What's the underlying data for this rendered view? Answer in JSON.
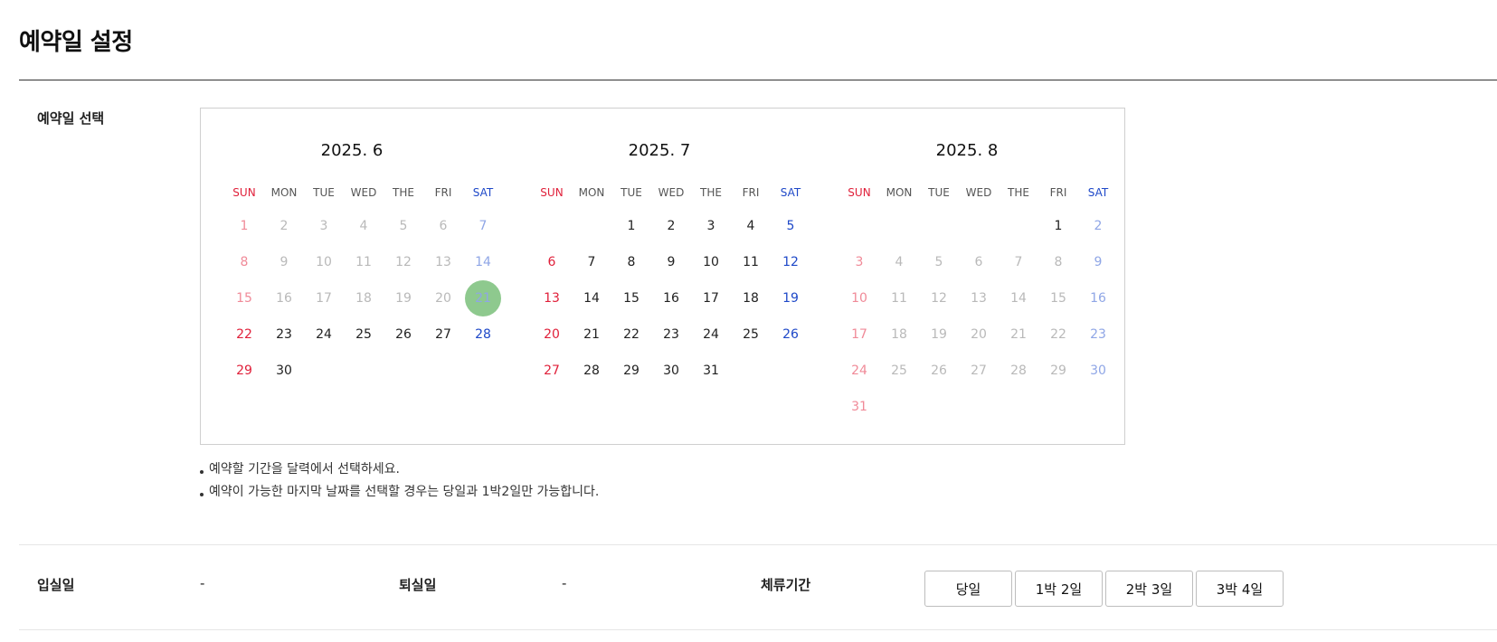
{
  "page": {
    "title": "예약일 설정"
  },
  "labels": {
    "select_date": "예약일 선택",
    "checkin": "입실일",
    "checkout": "퇴실일",
    "stay_period": "체류기간"
  },
  "values": {
    "checkin": "-",
    "checkout": "-"
  },
  "weekdays": [
    "SUN",
    "MON",
    "TUE",
    "WED",
    "THE",
    "FRI",
    "SAT"
  ],
  "colors": {
    "sunday": "#e0203a",
    "saturday": "#1e48c8",
    "selected": "#8ec98e",
    "disabled": "#b9b9b9"
  },
  "months": [
    {
      "title": "2025. 6",
      "weeks": [
        [
          "1",
          "2",
          "3",
          "4",
          "5",
          "6",
          "7"
        ],
        [
          "8",
          "9",
          "10",
          "11",
          "12",
          "13",
          "14"
        ],
        [
          "15",
          "16",
          "17",
          "18",
          "19",
          "20",
          "21"
        ],
        [
          "22",
          "23",
          "24",
          "25",
          "26",
          "27",
          "28"
        ],
        [
          "29",
          "30",
          "",
          "",
          "",
          "",
          ""
        ]
      ],
      "disabled_until": 21,
      "disabled_from": 0,
      "selected": 21
    },
    {
      "title": "2025. 7",
      "weeks": [
        [
          "",
          "",
          "1",
          "2",
          "3",
          "4",
          "5"
        ],
        [
          "6",
          "7",
          "8",
          "9",
          "10",
          "11",
          "12"
        ],
        [
          "13",
          "14",
          "15",
          "16",
          "17",
          "18",
          "19"
        ],
        [
          "20",
          "21",
          "22",
          "23",
          "24",
          "25",
          "26"
        ],
        [
          "27",
          "28",
          "29",
          "30",
          "31",
          "",
          ""
        ]
      ],
      "disabled_until": 0,
      "disabled_from": 0,
      "selected": 0
    },
    {
      "title": "2025. 8",
      "weeks": [
        [
          "",
          "",
          "",
          "",
          "",
          "1",
          "2"
        ],
        [
          "3",
          "4",
          "5",
          "6",
          "7",
          "8",
          "9"
        ],
        [
          "10",
          "11",
          "12",
          "13",
          "14",
          "15",
          "16"
        ],
        [
          "17",
          "18",
          "19",
          "20",
          "21",
          "22",
          "23"
        ],
        [
          "24",
          "25",
          "26",
          "27",
          "28",
          "29",
          "30"
        ],
        [
          "31",
          "",
          "",
          "",
          "",
          "",
          ""
        ]
      ],
      "disabled_until": 0,
      "disabled_from": 2,
      "selected": 0
    }
  ],
  "notes": [
    "예약할 기간을 달력에서 선택하세요.",
    "예약이 가능한 마지막 날짜를 선택할 경우는 당일과 1박2일만 가능합니다."
  ],
  "stay_options": [
    "당일",
    "1박 2일",
    "2박 3일",
    "3박 4일"
  ]
}
